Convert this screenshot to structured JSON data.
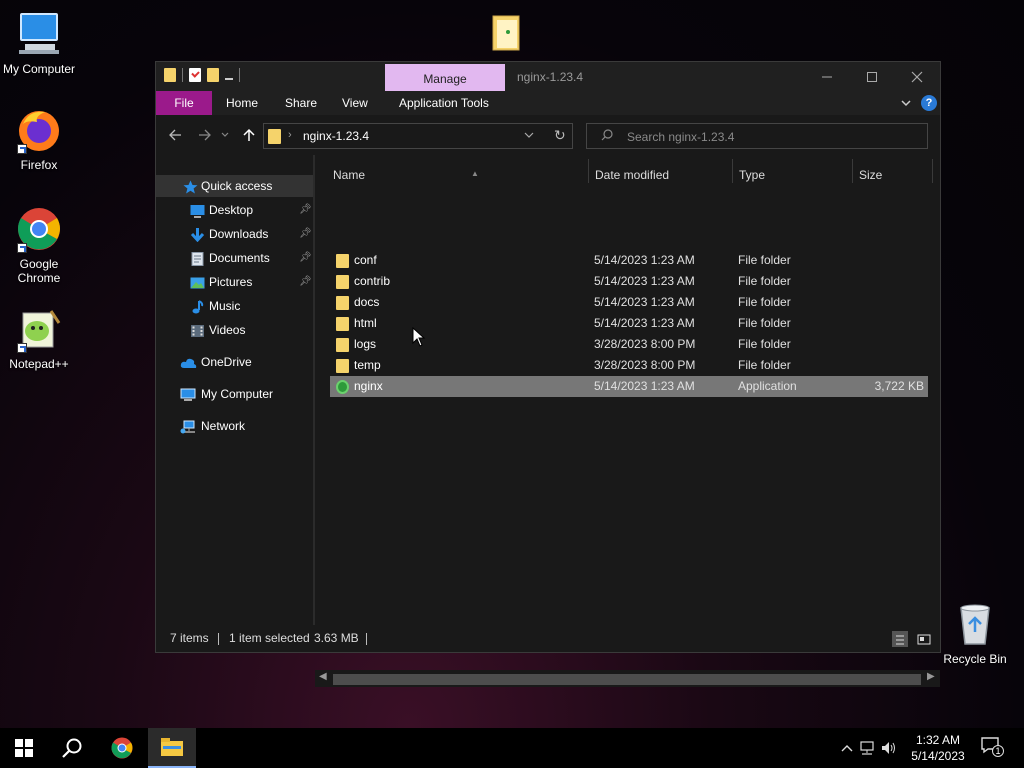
{
  "desktop": {
    "icons": [
      {
        "label": "My Computer"
      },
      {
        "label": "Firefox"
      },
      {
        "label": "Google\nChrome"
      },
      {
        "label": "Notepad++"
      },
      {
        "label": "Recycle Bin"
      }
    ]
  },
  "window": {
    "title": "nginx-1.23.4",
    "manage_tab": "Manage",
    "ribbon_tabs": [
      "File",
      "Home",
      "Share",
      "View",
      "Application Tools"
    ],
    "help": "?",
    "address_path": "nginx-1.23.4",
    "search_placeholder": "Search nginx-1.23.4"
  },
  "nav_pane": {
    "items": [
      {
        "label": "Quick access",
        "icon": "star-icon"
      },
      {
        "label": "Desktop",
        "icon": "desktop-icon",
        "pinned": true
      },
      {
        "label": "Downloads",
        "icon": "download-icon",
        "pinned": true
      },
      {
        "label": "Documents",
        "icon": "documents-icon",
        "pinned": true
      },
      {
        "label": "Pictures",
        "icon": "pictures-icon",
        "pinned": true
      },
      {
        "label": "Music",
        "icon": "music-icon"
      },
      {
        "label": "Videos",
        "icon": "videos-icon"
      },
      {
        "label": "OneDrive",
        "icon": "cloud-icon"
      },
      {
        "label": "My Computer",
        "icon": "computer-icon"
      },
      {
        "label": "Network",
        "icon": "network-icon"
      }
    ]
  },
  "file_list": {
    "columns": [
      "Name",
      "Date modified",
      "Type",
      "Size"
    ],
    "rows": [
      {
        "name": "conf",
        "date": "5/14/2023 1:23 AM",
        "type": "File folder",
        "size": "",
        "icon": "folder-icon"
      },
      {
        "name": "contrib",
        "date": "5/14/2023 1:23 AM",
        "type": "File folder",
        "size": "",
        "icon": "folder-icon"
      },
      {
        "name": "docs",
        "date": "5/14/2023 1:23 AM",
        "type": "File folder",
        "size": "",
        "icon": "folder-icon"
      },
      {
        "name": "html",
        "date": "5/14/2023 1:23 AM",
        "type": "File folder",
        "size": "",
        "icon": "folder-icon"
      },
      {
        "name": "logs",
        "date": "3/28/2023 8:00 PM",
        "type": "File folder",
        "size": "",
        "icon": "folder-icon"
      },
      {
        "name": "temp",
        "date": "3/28/2023 8:00 PM",
        "type": "File folder",
        "size": "",
        "icon": "folder-icon"
      },
      {
        "name": "nginx",
        "date": "5/14/2023 1:23 AM",
        "type": "Application",
        "size": "3,722 KB",
        "icon": "nginx-app-icon",
        "selected": true
      }
    ]
  },
  "status": {
    "item_count": "7 items",
    "selection": "1 item selected",
    "selection_size": "3.63 MB"
  },
  "taskbar": {
    "time": "1:32 AM",
    "date": "5/14/2023",
    "notification_count": "1"
  },
  "colors": {
    "file_tab": "#9b1a8b",
    "manage_tab": "#e2b8f0",
    "folder": "#f5d36b",
    "selection": "#777777"
  }
}
